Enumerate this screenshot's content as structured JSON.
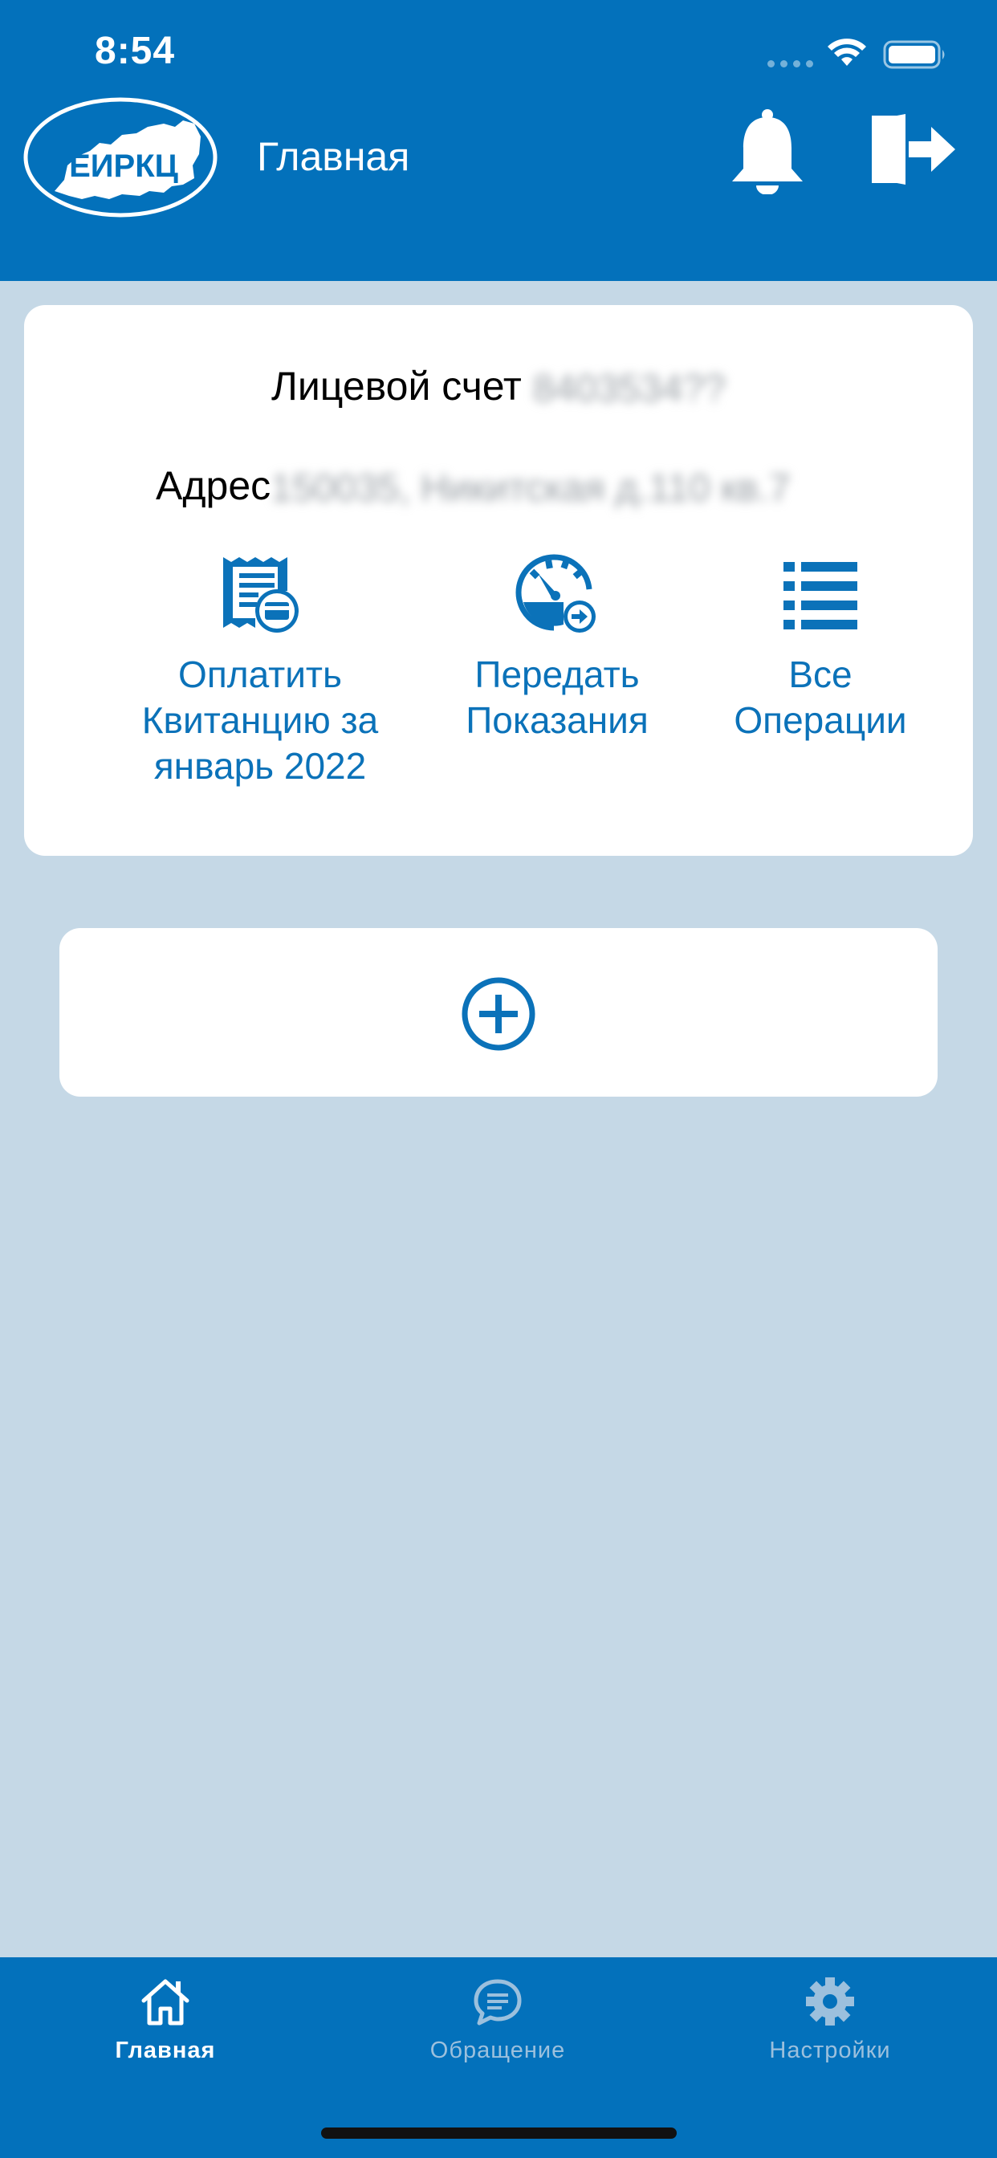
{
  "status_bar": {
    "time": "8:54"
  },
  "header": {
    "logo_text": "ЕИРКЦ",
    "title": "Главная",
    "bell_icon": "bell-icon",
    "logout_icon": "logout-icon"
  },
  "account": {
    "account_label": "Лицевой счет",
    "account_number": "8403534??",
    "address_label": "Адрес",
    "address_value": "150035, Никитская д.110 кв.7",
    "actions": [
      {
        "label": "Оплатить\nКвитанцию за\nянварь 2022",
        "icon": "receipt-card-icon"
      },
      {
        "label": "Передать\nПоказания",
        "icon": "meter-arrow-icon"
      },
      {
        "label": "Все\nОперации",
        "icon": "list-icon"
      }
    ]
  },
  "add_account": {
    "icon": "plus-circle-icon"
  },
  "tabbar": {
    "tabs": [
      {
        "label": "Главная",
        "icon": "home-icon",
        "active": true
      },
      {
        "label": "Обращение",
        "icon": "chat-icon",
        "active": false
      },
      {
        "label": "Настройки",
        "icon": "gear-icon",
        "active": false
      }
    ]
  },
  "colors": {
    "primary": "#0371bb",
    "background": "#c5d8e6",
    "link": "#0b72b9",
    "inactive_tab": "#9cc0dd"
  }
}
